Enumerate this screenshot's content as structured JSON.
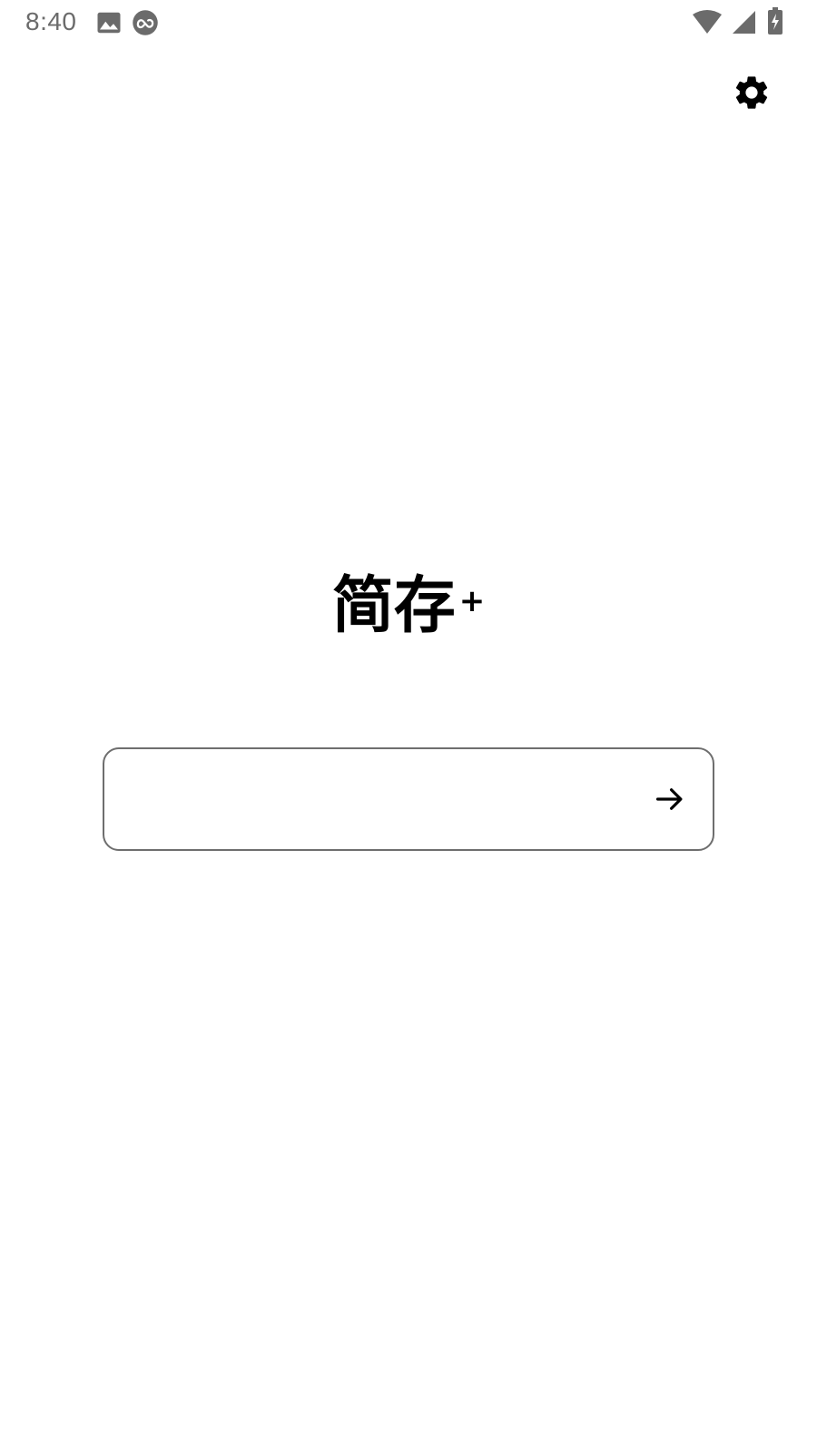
{
  "status_bar": {
    "time": "8:40",
    "icons": [
      "gallery-icon",
      "sync-icon",
      "wifi-icon",
      "signal-icon",
      "battery-charging-icon"
    ]
  },
  "header": {
    "settings_icon": "gear-icon"
  },
  "main": {
    "title": "简存",
    "title_superscript": "+",
    "input": {
      "value": "",
      "placeholder": ""
    },
    "submit_icon": "arrow-right-icon"
  },
  "colors": {
    "background": "#ffffff",
    "text": "#000000",
    "status_gray": "#6b6b6b",
    "input_border": "#6e6e6e"
  }
}
